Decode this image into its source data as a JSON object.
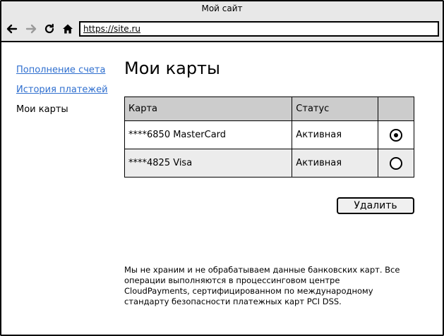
{
  "window": {
    "title": "Мой сайт"
  },
  "browser": {
    "url": "https://site.ru",
    "back_icon": "arrow-left-icon",
    "forward_icon": "arrow-right-icon",
    "reload_icon": "reload-icon",
    "home_icon": "home-icon"
  },
  "sidebar": {
    "items": [
      {
        "label": "Пополнение счета",
        "link": true
      },
      {
        "label": "История платежей",
        "link": true
      },
      {
        "label": "Мои карты",
        "link": false
      }
    ]
  },
  "main": {
    "title": "Мои карты",
    "table": {
      "headers": [
        "Карта",
        "Статус",
        ""
      ],
      "rows": [
        {
          "card": "****6850 MasterCard",
          "status": "Активная",
          "selected": true
        },
        {
          "card": "****4825 Visa",
          "status": "Активная",
          "selected": false
        }
      ]
    },
    "delete_label": "Удалить",
    "disclaimer": "Мы не храним и не обрабатываем данные банковских карт. Все операции выполняются в процессинговом центре CloudPayments, сертифицированном по международному стандарту безопасности платежных карт PCI DSS."
  },
  "colors": {
    "link": "#2f6fcf",
    "header_bg": "#cccccc",
    "chrome_bg": "#e8e8e8"
  }
}
